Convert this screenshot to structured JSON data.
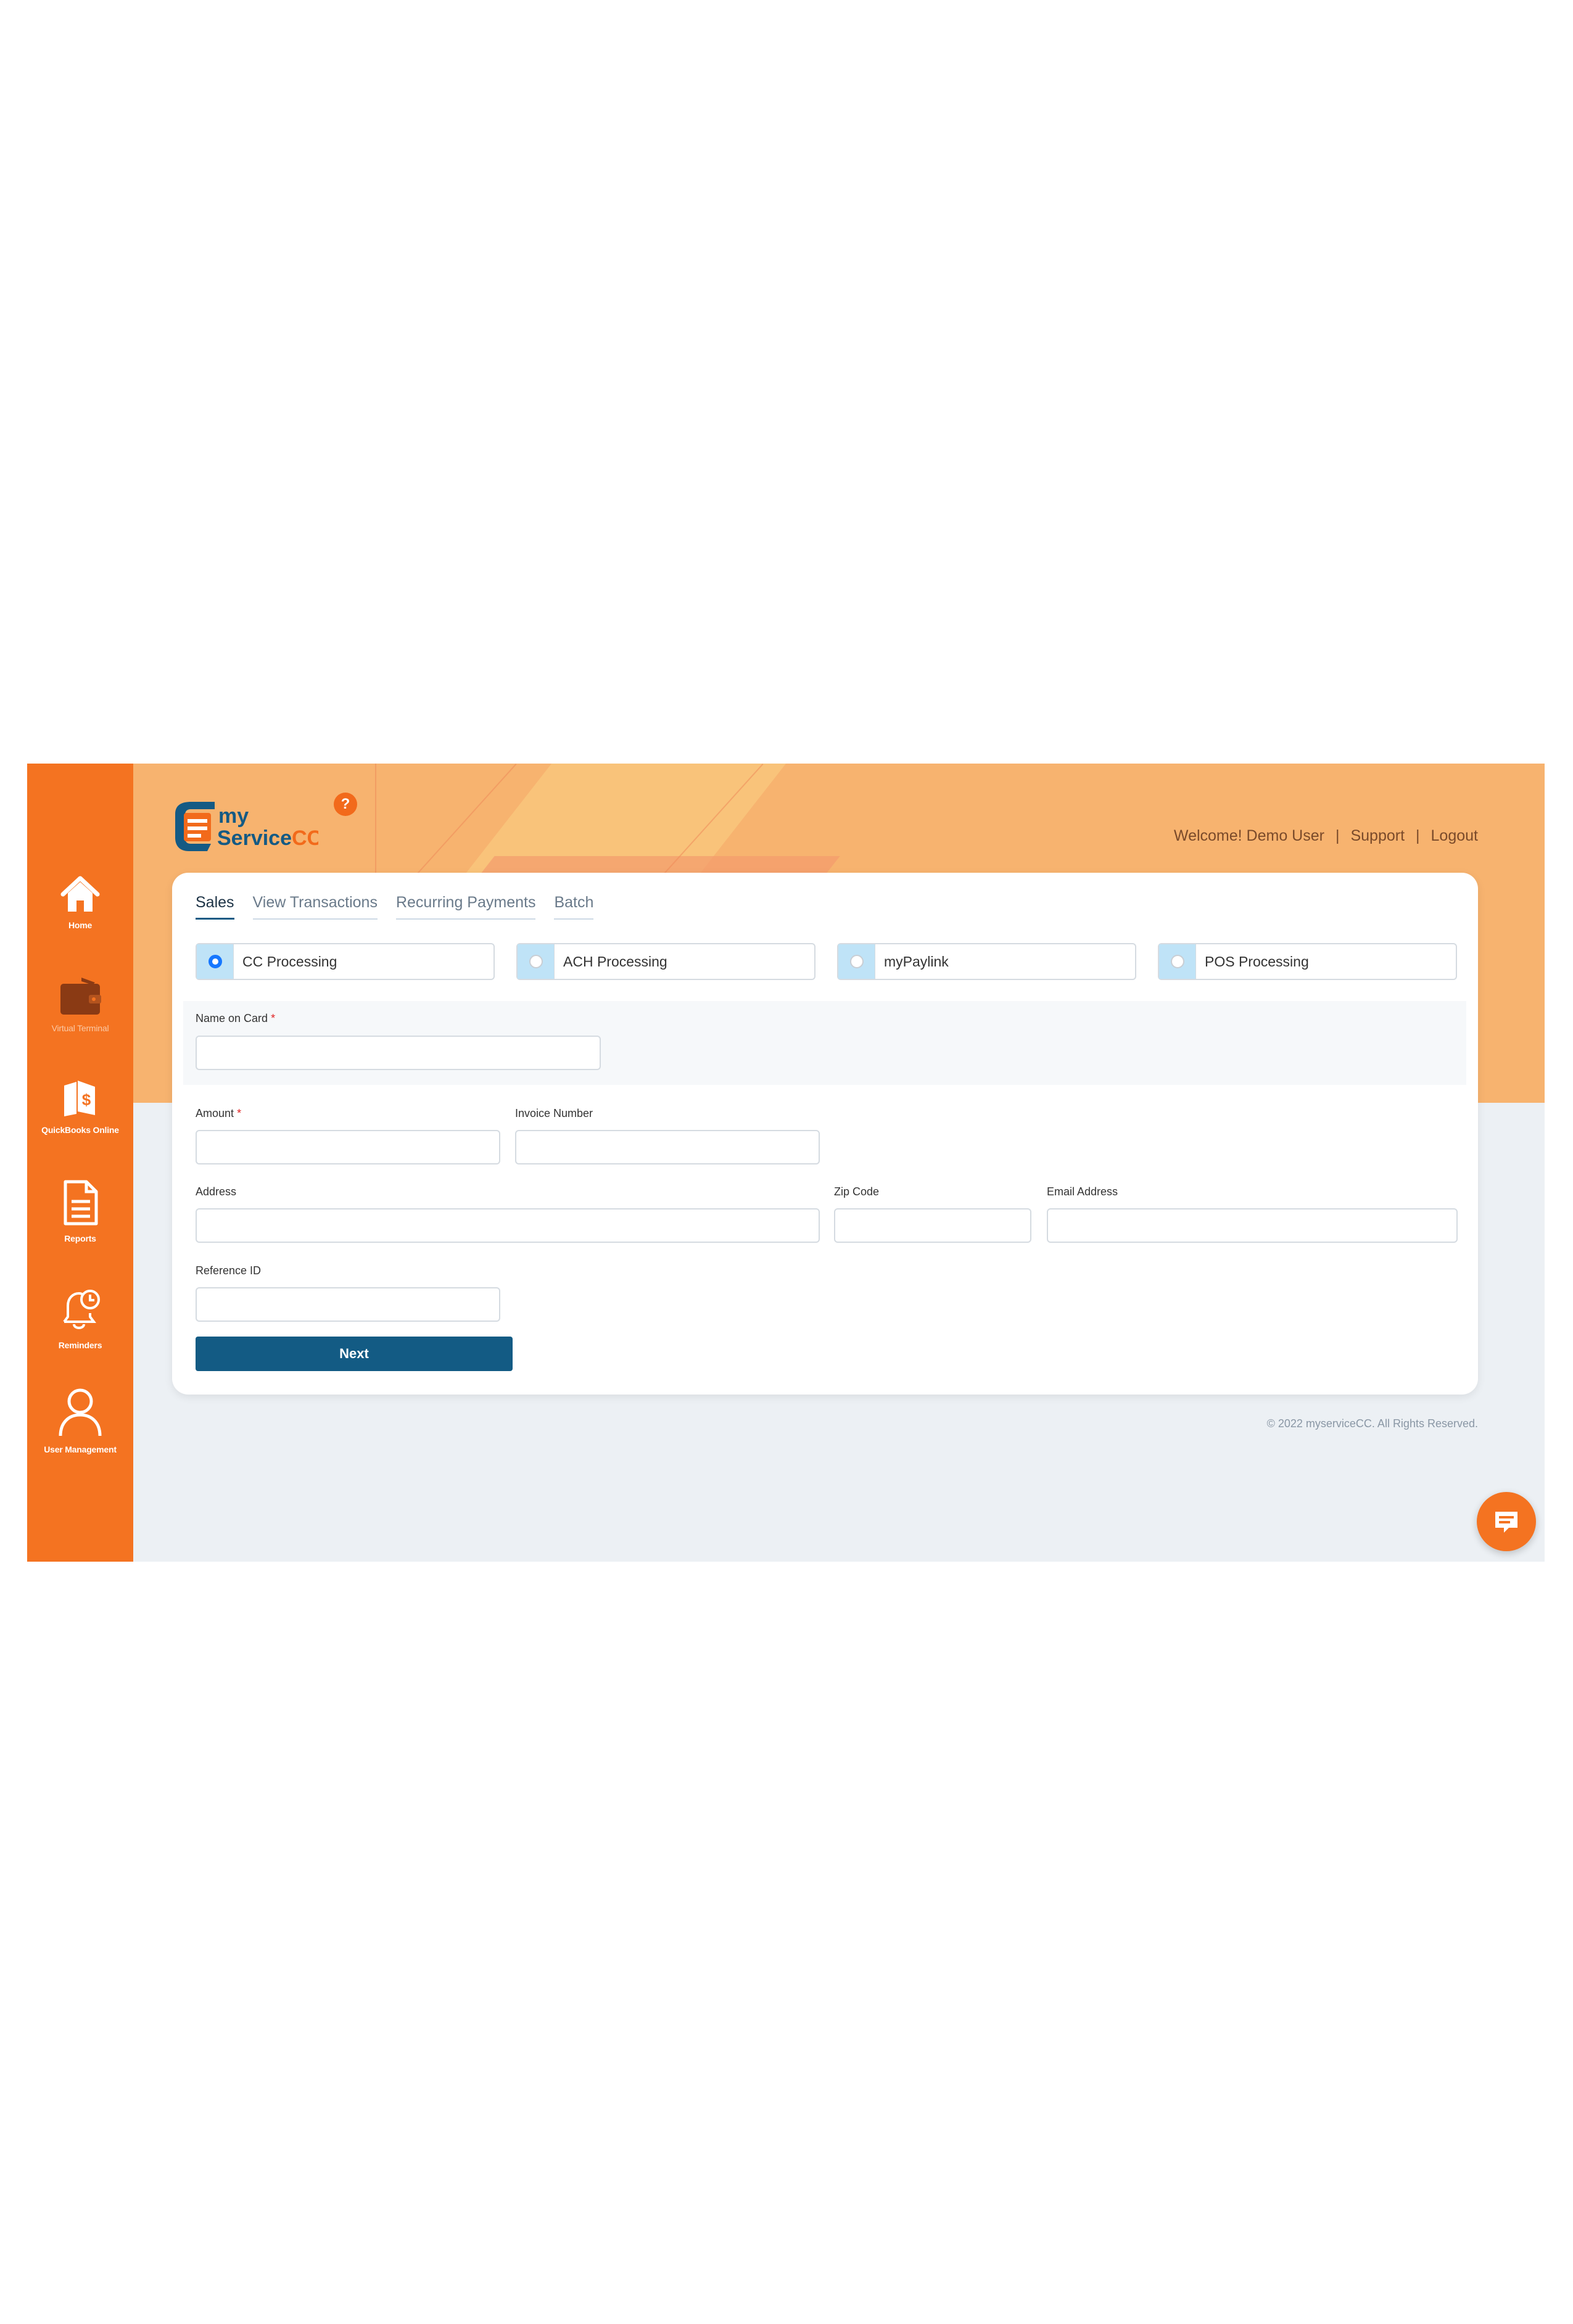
{
  "sidebar": {
    "items": [
      {
        "label": "Home",
        "icon": "home-icon"
      },
      {
        "label": "Virtual Terminal",
        "icon": "wallet-icon"
      },
      {
        "label": "QuickBooks Online",
        "icon": "quickbooks-icon"
      },
      {
        "label": "Reports",
        "icon": "document-icon"
      },
      {
        "label": "Reminders",
        "icon": "bell-clock-icon"
      },
      {
        "label": "User Management",
        "icon": "user-icon"
      }
    ]
  },
  "brand": {
    "logo_line1": "my",
    "logo_line2": "Service",
    "logo_accent": "CC",
    "help": "?"
  },
  "header": {
    "welcome": "Welcome! Demo User",
    "support": "Support",
    "logout": "Logout",
    "separator": "|"
  },
  "tabs": [
    {
      "label": "Sales",
      "active": true
    },
    {
      "label": "View Transactions",
      "active": false
    },
    {
      "label": "Recurring Payments",
      "active": false
    },
    {
      "label": "Batch",
      "active": false
    }
  ],
  "processing_options": [
    {
      "label": "CC Processing",
      "selected": true
    },
    {
      "label": "ACH Processing",
      "selected": false
    },
    {
      "label": "myPaylink",
      "selected": false
    },
    {
      "label": "POS Processing",
      "selected": false
    }
  ],
  "form": {
    "name_on_card": {
      "label": "Name on Card",
      "required": "*",
      "value": ""
    },
    "amount": {
      "label": "Amount",
      "required": "*",
      "value": ""
    },
    "invoice_number": {
      "label": "Invoice Number",
      "value": ""
    },
    "address": {
      "label": "Address",
      "value": ""
    },
    "zip_code": {
      "label": "Zip Code",
      "value": ""
    },
    "email_address": {
      "label": "Email Address",
      "value": ""
    },
    "reference_id": {
      "label": "Reference ID",
      "value": ""
    },
    "next_label": "Next"
  },
  "footer": {
    "copyright": "© 2022 myserviceCC. All Rights Reserved."
  },
  "colors": {
    "sidebar": "#f47321",
    "banner": "#f7b36f",
    "primary_button": "#135b84",
    "radio_selected": "#1677ff",
    "background": "#ecf0f4"
  }
}
